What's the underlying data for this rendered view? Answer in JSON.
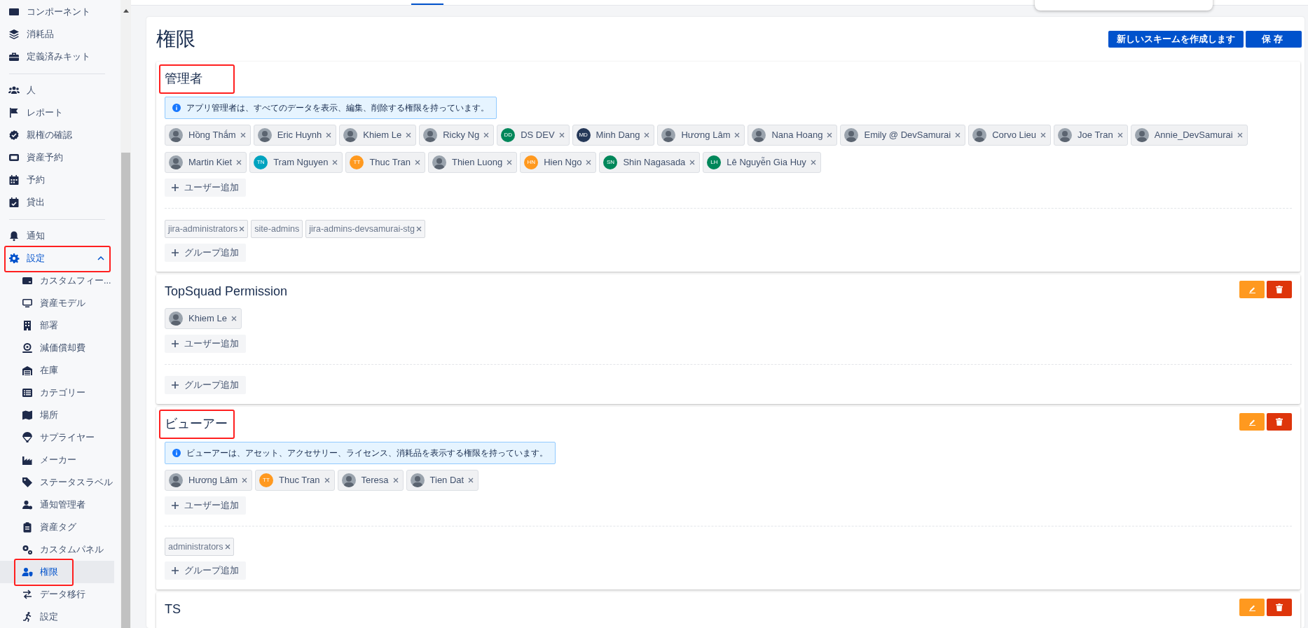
{
  "sidebar": {
    "groups": [
      {
        "items": [
          {
            "label": "コンポーネント",
            "selected": false,
            "highlighted": false
          },
          {
            "label": "消耗品",
            "selected": false,
            "highlighted": false
          },
          {
            "label": "定義済みキット",
            "selected": false,
            "highlighted": false
          }
        ]
      },
      {
        "items": [
          {
            "label": "人",
            "selected": false,
            "highlighted": false
          },
          {
            "label": "レポート",
            "selected": false,
            "highlighted": false
          },
          {
            "label": "親権の確認",
            "selected": false,
            "highlighted": false
          },
          {
            "label": "資産予約",
            "selected": false,
            "highlighted": false
          },
          {
            "label": "予約",
            "selected": false,
            "highlighted": false
          },
          {
            "label": "貸出",
            "selected": false,
            "highlighted": false
          }
        ]
      },
      {
        "items": [
          {
            "label": "通知",
            "selected": false,
            "highlighted": false
          },
          {
            "label": "設定",
            "selected": false,
            "highlighted": true,
            "expanded": true,
            "children": [
              {
                "label": "カスタムフィー...",
                "selected": false,
                "highlighted": false
              },
              {
                "label": "資産モデル",
                "selected": false,
                "highlighted": false
              },
              {
                "label": "部署",
                "selected": false,
                "highlighted": false
              },
              {
                "label": "減価償却費",
                "selected": false,
                "highlighted": false
              },
              {
                "label": "在庫",
                "selected": false,
                "highlighted": false
              },
              {
                "label": "カテゴリー",
                "selected": false,
                "highlighted": false
              },
              {
                "label": "場所",
                "selected": false,
                "highlighted": false
              },
              {
                "label": "サプライヤー",
                "selected": false,
                "highlighted": false
              },
              {
                "label": "メーカー",
                "selected": false,
                "highlighted": false
              },
              {
                "label": "ステータスラベル",
                "selected": false,
                "highlighted": false
              },
              {
                "label": "通知管理者",
                "selected": false,
                "highlighted": false
              },
              {
                "label": "資産タグ",
                "selected": false,
                "highlighted": false
              },
              {
                "label": "カスタムパネル",
                "selected": false,
                "highlighted": false
              },
              {
                "label": "権限",
                "selected": true,
                "highlighted": true
              },
              {
                "label": "データ移行",
                "selected": false,
                "highlighted": false
              },
              {
                "label": "設定",
                "selected": false,
                "highlighted": false
              }
            ]
          }
        ]
      }
    ]
  },
  "page": {
    "title": "権限",
    "buttons": [
      {
        "label": "新しいスキームを作成します"
      },
      {
        "label": "保存"
      }
    ]
  },
  "schemes": [
    {
      "name": "管理者",
      "highlighted": true,
      "editable": false,
      "info": "アプリ管理者は、すべてのデータを表示、編集、削除する権限を持っています。",
      "users": [
        {
          "name": "Hồng Thắm",
          "avatar": {
            "kind": "photo"
          }
        },
        {
          "name": "Eric Huynh",
          "avatar": {
            "kind": "photo"
          }
        },
        {
          "name": "Khiem Le",
          "avatar": {
            "kind": "photo"
          }
        },
        {
          "name": "Ricky Ng",
          "avatar": {
            "kind": "photo"
          }
        },
        {
          "name": "DS DEV",
          "avatar": {
            "kind": "initials",
            "initials": "DD",
            "color": "#00875a"
          }
        },
        {
          "name": "Minh Dang",
          "avatar": {
            "kind": "initials",
            "initials": "MD",
            "color": "#253858"
          }
        },
        {
          "name": "Hương Lâm",
          "avatar": {
            "kind": "photo"
          }
        },
        {
          "name": "Nana Hoang",
          "avatar": {
            "kind": "photo"
          }
        },
        {
          "name": "Emily @ DevSamurai",
          "avatar": {
            "kind": "photo"
          }
        },
        {
          "name": "Corvo Lieu",
          "avatar": {
            "kind": "photo"
          }
        },
        {
          "name": "Joe Tran",
          "avatar": {
            "kind": "photo"
          }
        },
        {
          "name": "Annie_DevSamurai",
          "avatar": {
            "kind": "photo"
          }
        },
        {
          "name": "Martin Kiet",
          "avatar": {
            "kind": "photo"
          }
        },
        {
          "name": "Tram Nguyen",
          "avatar": {
            "kind": "initials",
            "initials": "TN",
            "color": "#00a3bf"
          }
        },
        {
          "name": "Thuc Tran",
          "avatar": {
            "kind": "initials",
            "initials": "TT",
            "color": "#ff991f"
          }
        },
        {
          "name": "Thien Luong",
          "avatar": {
            "kind": "photo"
          }
        },
        {
          "name": "Hien Ngo",
          "avatar": {
            "kind": "initials",
            "initials": "HN",
            "color": "#ff991f"
          }
        },
        {
          "name": "Shin Nagasada",
          "avatar": {
            "kind": "initials",
            "initials": "SN",
            "color": "#00875a"
          }
        },
        {
          "name": "Lê Nguyễn Gia Huy",
          "avatar": {
            "kind": "initials",
            "initials": "LH",
            "color": "#00875a"
          }
        }
      ],
      "add_user_label": "ユーザー追加",
      "groups": [
        {
          "name": "jira-administrators",
          "removable": true
        },
        {
          "name": "site-admins",
          "removable": false
        },
        {
          "name": "jira-admins-devsamurai-stg",
          "removable": true
        }
      ],
      "add_group_label": "グループ追加"
    },
    {
      "name": "TopSquad Permission",
      "highlighted": false,
      "editable": true,
      "users": [
        {
          "name": "Khiem Le",
          "avatar": {
            "kind": "photo"
          }
        }
      ],
      "add_user_label": "ユーザー追加",
      "add_group_label": "グループ追加"
    },
    {
      "name": "ビューアー",
      "highlighted": true,
      "editable": true,
      "info": "ビューアーは、アセット、アクセサリー、ライセンス、消耗品を表示する権限を持っています。",
      "users": [
        {
          "name": "Hương Lâm",
          "avatar": {
            "kind": "photo"
          }
        },
        {
          "name": "Thuc Tran",
          "avatar": {
            "kind": "initials",
            "initials": "TT",
            "color": "#ff991f"
          }
        },
        {
          "name": "Teresa",
          "avatar": {
            "kind": "photo"
          }
        },
        {
          "name": "Tien Dat",
          "avatar": {
            "kind": "photo"
          }
        }
      ],
      "add_user_label": "ユーザー追加",
      "groups": [
        {
          "name": "administrators",
          "removable": true
        }
      ],
      "add_group_label": "グループ追加"
    },
    {
      "name": "TS",
      "highlighted": false,
      "editable": true
    }
  ]
}
